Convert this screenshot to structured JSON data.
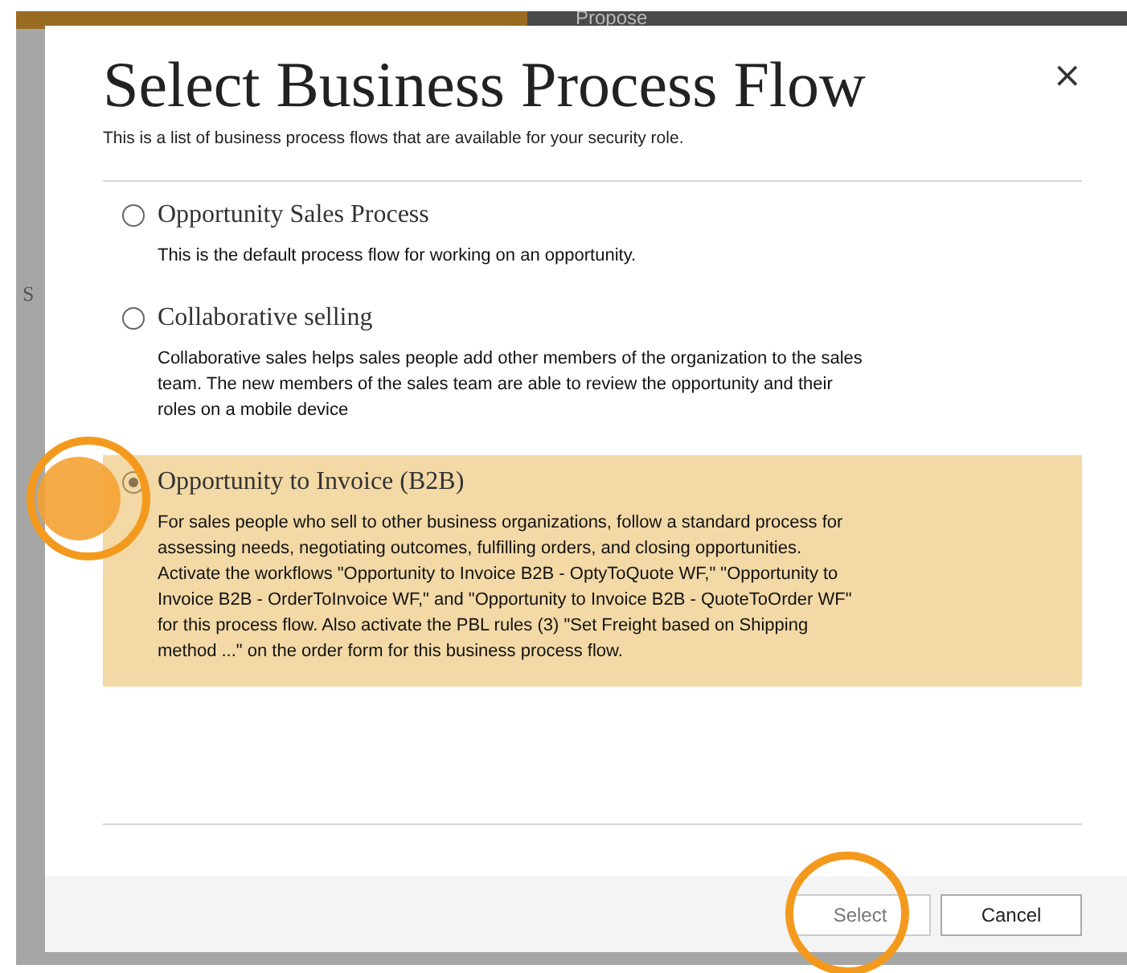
{
  "background": {
    "stage_label": "Propose",
    "side_label": "S"
  },
  "dialog": {
    "title": "Select Business Process Flow",
    "subtitle": "This is a list of business process flows that are available for your security role.",
    "close": "×",
    "options": [
      {
        "title": "Opportunity Sales Process",
        "description": "This is the default process flow for working on an opportunity.",
        "selected": false
      },
      {
        "title": "Collaborative selling",
        "description": "Collaborative sales helps sales people add other members of the organization to the sales team. The new members of the sales team are able to review the opportunity and their roles on a mobile device",
        "selected": false
      },
      {
        "title": "Opportunity to Invoice (B2B)",
        "description": "For sales people who sell to other business organizations, follow a standard process for assessing needs, negotiating outcomes, fulfilling orders, and closing opportunities. Activate the workflows \"Opportunity to Invoice B2B - OptyToQuote WF,\" \"Opportunity to Invoice B2B - OrderToInvoice WF,\" and \"Opportunity to Invoice B2B - QuoteToOrder WF\" for this process flow. Also activate the PBL rules (3) \"Set Freight based on Shipping method ...\" on the order form for this business process flow.",
        "selected": true
      }
    ],
    "buttons": [
      {
        "label": "Select",
        "disabled": true
      },
      {
        "label": "Cancel",
        "disabled": false
      }
    ]
  }
}
